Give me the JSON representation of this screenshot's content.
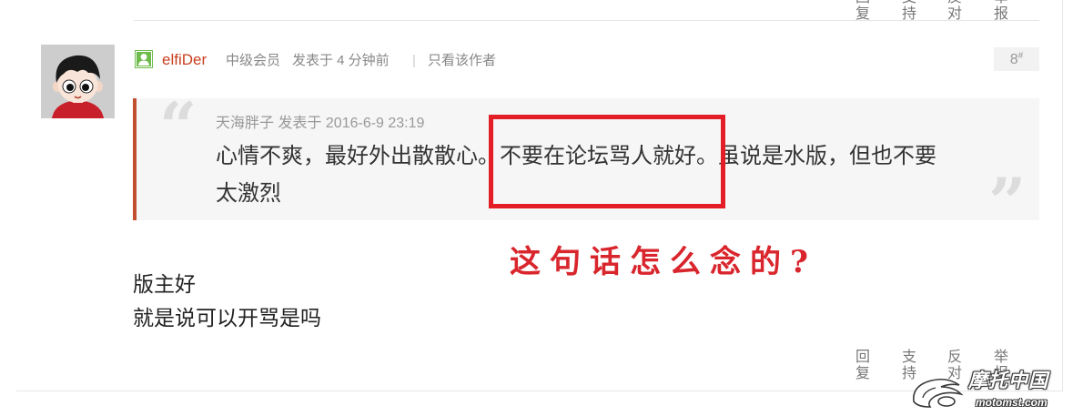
{
  "prev_post": {
    "actions": [
      "回复",
      "支持",
      "反对",
      "举报"
    ]
  },
  "post": {
    "floor": "8",
    "floor_suffix": "#",
    "author": {
      "name": "elfiDer",
      "rank": "中级会员",
      "posted": "发表于 4 分钟前",
      "separator": "|",
      "only_author_link": "只看该作者",
      "avatar_icon": "cartoon-boy-avatar",
      "status_icon": "online-user-icon"
    },
    "quote": {
      "open_mark": "“",
      "close_mark": "”",
      "meta": "天海胖子 发表于 2016-6-9 23:19",
      "line1": "心情不爽，最好外出散散心。不要在论坛骂人就好。虽说是水版，但也不要",
      "line2": "太激烈"
    },
    "content": [
      "版主好",
      "就是说可以开骂是吗"
    ],
    "actions": [
      "回复",
      "支持",
      "反对",
      "举报"
    ]
  },
  "annotation": {
    "text": "这句话怎么念的?",
    "color": "#d9262d",
    "box_color": "#e41e26"
  },
  "watermark": {
    "title": "摩托中国",
    "url": "motomst.com"
  },
  "colors": {
    "author_name": "#c9401f",
    "quote_border": "#c2502e",
    "quote_background": "#f6f6f6",
    "muted_text": "#888888",
    "online_icon": "#6dbb4a"
  }
}
